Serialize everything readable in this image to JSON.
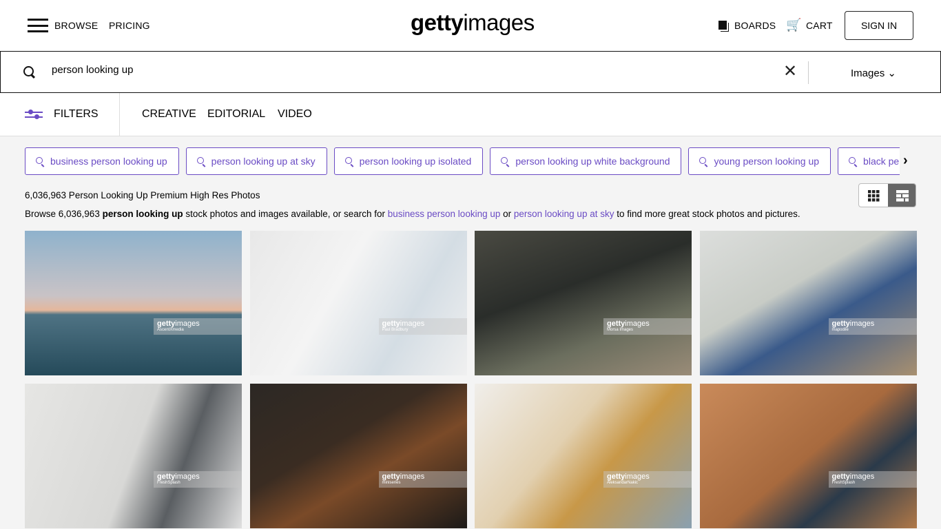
{
  "header": {
    "browse": "BROWSE",
    "pricing": "PRICING",
    "logo": "gettyimages",
    "boards": "BOARDS",
    "cart": "CART",
    "sign_in": "SIGN IN"
  },
  "search": {
    "query": "person looking up",
    "type": "Images"
  },
  "filters": {
    "label": "FILTERS",
    "tabs": [
      "CREATIVE",
      "EDITORIAL",
      "VIDEO"
    ]
  },
  "related": [
    "business person looking up",
    "person looking up at sky",
    "person looking up isolated",
    "person looking up white background",
    "young person looking up",
    "black person looking up"
  ],
  "results": {
    "count_title": "6,036,963 Person Looking Up Premium High Res Photos",
    "desc_pre": "Browse 6,036,963 ",
    "desc_bold": "person looking up",
    "desc_mid": " stock photos and images available, or search for ",
    "link1": "business person looking up",
    "desc_or": " or ",
    "link2": "person looking up at sky",
    "desc_post": " to find more great stock photos and pictures."
  },
  "accent": "#6a4bc4",
  "images": [
    {
      "credit": "AscentXmedia",
      "bg": "linear-gradient(180deg,#8fb2cc 0%,#c9c3c6 45%,#e4b79c 55%,#4f7384 58%,#254a5a 100%)"
    },
    {
      "credit": "Paul Bradbury",
      "bg": "linear-gradient(120deg,#e8e8e8,#f4f4f4 40%,#d4dde4 70%,#f0f0f0)"
    },
    {
      "credit": "Morsa Images",
      "bg": "linear-gradient(160deg,#4a4a42,#2a2d2a 40%,#6b6e5e 70%,#9a8c78)"
    },
    {
      "credit": "mapodile",
      "bg": "linear-gradient(150deg,#dcdedc,#c8ccc6 40%,#3a5a8a 60%,#a89070)"
    },
    {
      "credit": "FreshSplash",
      "bg": "linear-gradient(110deg,#e6e6e4,#d8d8d6 50%,#5a5e62 70%,#e0e0e0)"
    },
    {
      "credit": "miniseries",
      "bg": "linear-gradient(150deg,#2c2824,#3a2c22 40%,#7a4a28 60%,#1c1a18)"
    },
    {
      "credit": "AleksandarNakic",
      "bg": "linear-gradient(130deg,#f0eeea,#e2d0b0 40%,#c89848 60%,#8aa0b0)"
    },
    {
      "credit": "FreshSplash",
      "bg": "linear-gradient(140deg,#c98a5a,#a86a3e 50%,#2a3a4a 70%,#b07848)"
    }
  ]
}
